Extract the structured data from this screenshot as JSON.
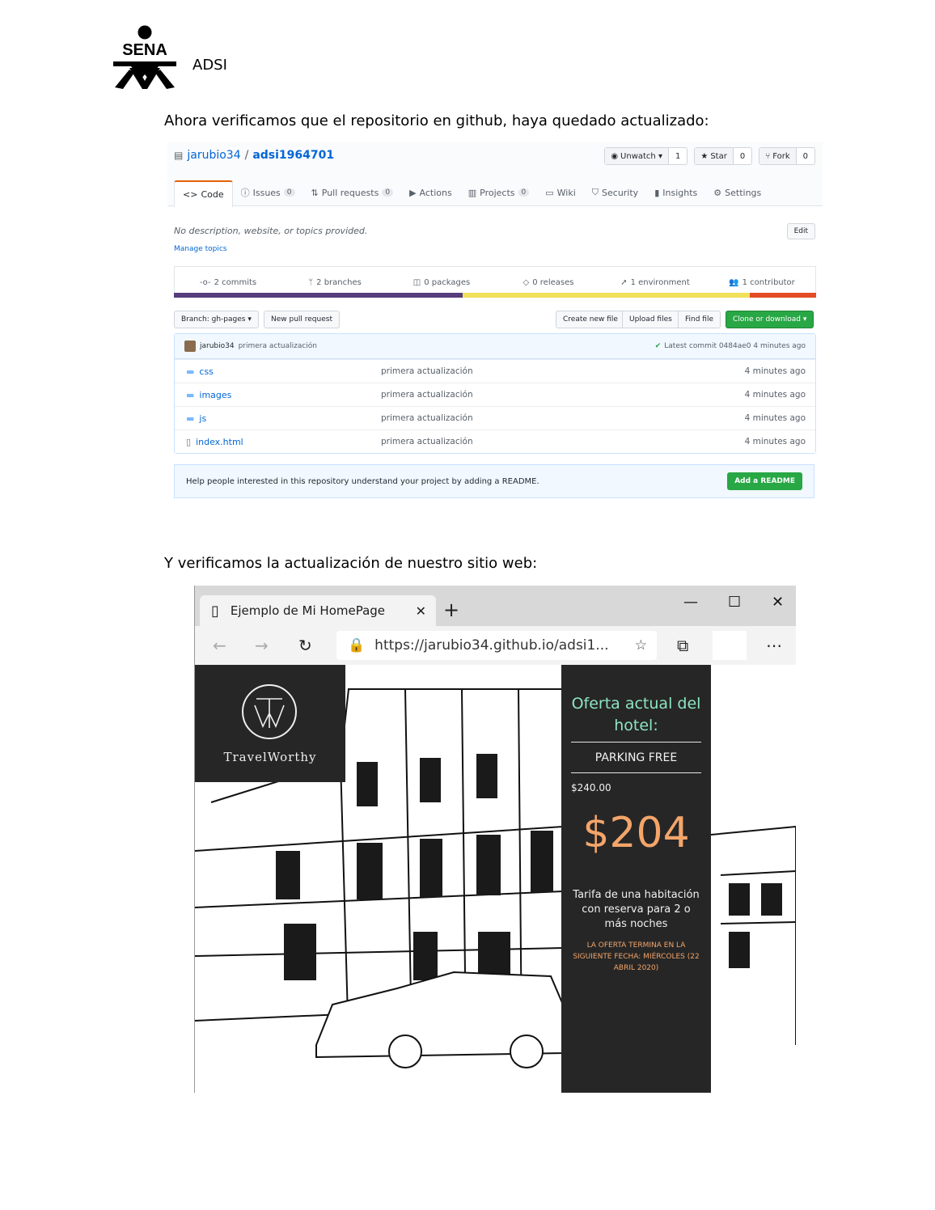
{
  "header": {
    "logo_text": "SENA",
    "label": "ADSI"
  },
  "paragraphs": {
    "p1": "Ahora verificamos que el repositorio en github, haya quedado actualizado:",
    "p2": "Y verificamos la actualización de nuestro sitio web:"
  },
  "github": {
    "owner": "jarubio34",
    "separator": "/",
    "repo": "adsi1964701",
    "buttons": {
      "unwatch": "Unwatch ▾",
      "unwatch_count": "1",
      "star": "Star",
      "star_count": "0",
      "fork": "Fork",
      "fork_count": "0"
    },
    "tabs": [
      {
        "label": "Code"
      },
      {
        "label": "Issues",
        "count": "0"
      },
      {
        "label": "Pull requests",
        "count": "0"
      },
      {
        "label": "Actions"
      },
      {
        "label": "Projects",
        "count": "0"
      },
      {
        "label": "Wiki"
      },
      {
        "label": "Security"
      },
      {
        "label": "Insights"
      },
      {
        "label": "Settings"
      }
    ],
    "description": "No description, website, or topics provided.",
    "manage_topics": "Manage topics",
    "edit": "Edit",
    "summary": {
      "commits": "2 commits",
      "branches": "2 branches",
      "packages": "0 packages",
      "releases": "0 releases",
      "environment": "1 environment",
      "contributor": "1 contributor"
    },
    "lang_colors": [
      "#563d7c",
      "#f1e05a",
      "#e34c26"
    ],
    "lang_fractions": [
      0.45,
      0.447,
      0.103
    ],
    "branch_button": "Branch: gh-pages ▾",
    "new_pr": "New pull request",
    "create_file": "Create new file",
    "upload_files": "Upload files",
    "find_file": "Find file",
    "clone": "Clone or download ▾",
    "commit": {
      "author": "jarubio34",
      "message": "primera actualización",
      "latest": "Latest commit 0484ae0 4 minutes ago"
    },
    "files": [
      {
        "name": "css",
        "type": "folder",
        "message": "primera actualización",
        "age": "4 minutes ago"
      },
      {
        "name": "images",
        "type": "folder",
        "message": "primera actualización",
        "age": "4 minutes ago"
      },
      {
        "name": "js",
        "type": "folder",
        "message": "primera actualización",
        "age": "4 minutes ago"
      },
      {
        "name": "index.html",
        "type": "file",
        "message": "primera actualización",
        "age": "4 minutes ago"
      }
    ],
    "readme_help": "Help people interested in this repository understand your project by adding a README.",
    "add_readme": "Add a README"
  },
  "browser": {
    "tab_title": "Ejemplo de Mi HomePage",
    "url": "https://jarubio34.github.io/adsi1...",
    "brand": "TravelWorthy",
    "offer": {
      "title": "Oferta actual del hotel:",
      "feature": "PARKING FREE",
      "old_price": "$240.00",
      "new_price": "$204",
      "tarifa": "Tarifa de una habitación con reserva para 2 o más noches",
      "ends": "LA OFERTA TERMINA EN LA SIGUIENTE FECHA: MIÉRCOLES (22 ABRIL 2020)"
    }
  }
}
